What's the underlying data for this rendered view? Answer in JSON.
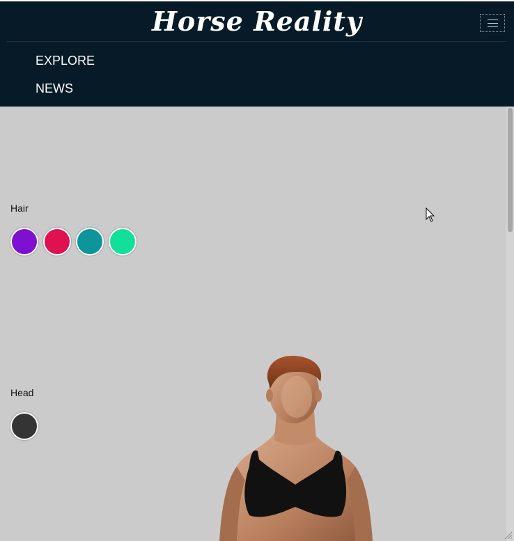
{
  "brand": {
    "title": "Horse Reality"
  },
  "nav": {
    "menu_icon": "hamburger-menu-icon",
    "links": [
      {
        "label": "EXPLORE"
      },
      {
        "label": "NEWS"
      }
    ]
  },
  "customizer": {
    "hair": {
      "label": "Hair",
      "colors": [
        "#7e10d1",
        "#e01150",
        "#0c959b",
        "#12e09a"
      ]
    },
    "head": {
      "label": "Head",
      "colors": [
        "#343434"
      ]
    }
  },
  "colors": {
    "navbar_bg": "#071a27",
    "page_bg": "#cbcbcb"
  }
}
